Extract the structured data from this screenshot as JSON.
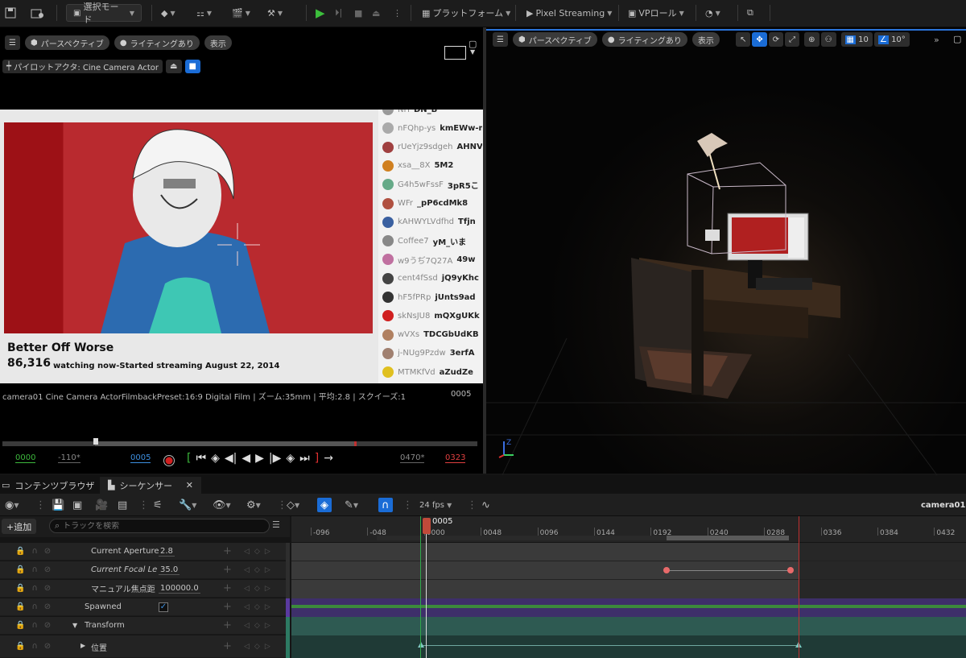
{
  "toolbar": {
    "mode_label": "選択モード",
    "platform_label": "プラットフォーム",
    "pixel_streaming_label": "Pixel Streaming",
    "vp_role_label": "VPロール"
  },
  "left_viewport": {
    "perspective": "パースペクティブ",
    "lighting": "ライティングあり",
    "show": "表示",
    "pilot": "パイロットアクタ: Cine Camera Actor",
    "stream_title": "Better Off Worse",
    "viewer_count": "86,316",
    "viewer_text": "watching now-Started streaming August 22, 2014",
    "chat": [
      {
        "user": "NH",
        "msg": "DN_B"
      },
      {
        "user": "nFQhp-ys",
        "msg": "kmEWw-m"
      },
      {
        "user": "rUeYjz9sdgeh",
        "msg": "AHNV"
      },
      {
        "user": "xsa__8X",
        "msg": "5M2"
      },
      {
        "user": "G4h5wFssF",
        "msg": "3pR5こ"
      },
      {
        "user": "WFr",
        "msg": "_pP6cdMk8"
      },
      {
        "user": "kAHWYLVdfhd",
        "msg": "Tfjn"
      },
      {
        "user": "Coffee7",
        "msg": "yM_いま"
      },
      {
        "user": "w9うぢ7Q27A",
        "msg": "49w"
      },
      {
        "user": "cent4fSsd",
        "msg": "jQ9yKhc"
      },
      {
        "user": "hF5fPRp",
        "msg": "jUnts9ad"
      },
      {
        "user": "skNsJU8",
        "msg": "mQXgUKk"
      },
      {
        "user": "wVXs",
        "msg": "TDCGbUdKB"
      },
      {
        "user": "j-NUg9Pzdw",
        "msg": "3erfA"
      },
      {
        "user": "MTMKfVd",
        "msg": "aZudZe"
      }
    ],
    "camera_info": "camera01  Cine Camera ActorFilmbackPreset:16:9 Digital Film | ズーム:35mm | 平均:2.8 | スクイーズ:1",
    "frame": "0005"
  },
  "transport": {
    "start": "0000",
    "in": "-110*",
    "current": "0005",
    "out": "0470*",
    "end": "0323"
  },
  "right_viewport": {
    "perspective": "パースペクティブ",
    "lighting": "ライティングあり",
    "show": "表示",
    "grid": "10",
    "angle": "10°"
  },
  "tabs": {
    "content": "コンテンツブラウザ",
    "sequencer": "シーケンサー"
  },
  "sequencer": {
    "fps": "24 fps",
    "camera": "camera01",
    "add": "+追加",
    "search_placeholder": "トラックを検索",
    "playhead": "0005",
    "ruler": [
      "-096",
      "-048",
      "0000",
      "0048",
      "0096",
      "0144",
      "0192",
      "0240",
      "0288",
      "0336",
      "0384",
      "0432"
    ],
    "tracks": [
      {
        "label": "Current Aperture",
        "value": "2.8"
      },
      {
        "label": "Current Focal Le",
        "value": "35.0"
      },
      {
        "label": "マニュアル焦点距",
        "value": "100000.0"
      },
      {
        "label": "Spawned",
        "value": ""
      },
      {
        "label": "Transform",
        "value": ""
      },
      {
        "label": "位置",
        "value": ""
      }
    ]
  }
}
